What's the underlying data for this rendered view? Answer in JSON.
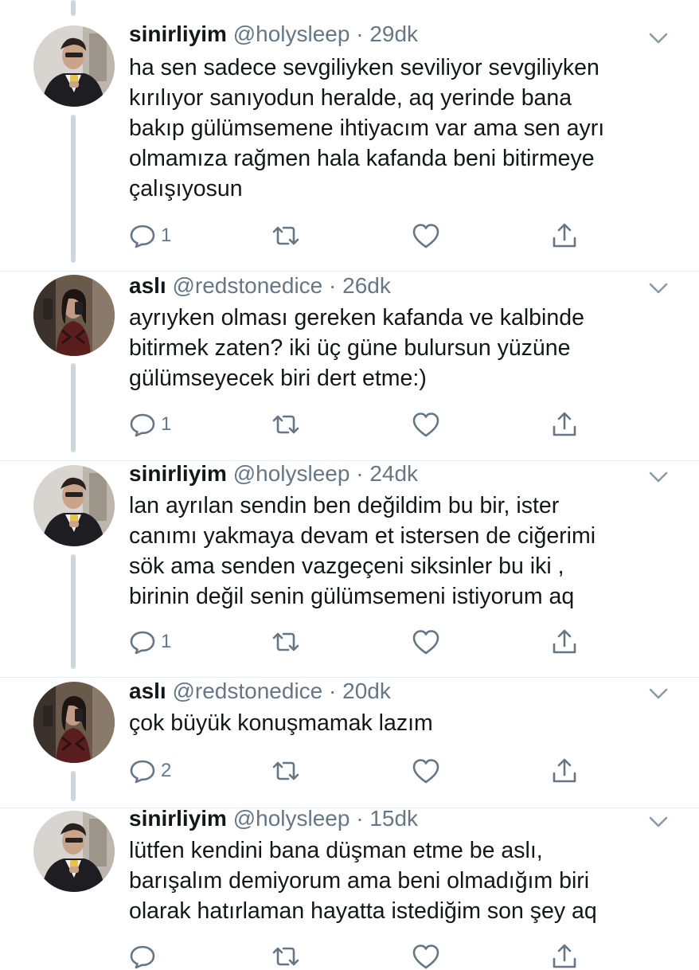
{
  "tweets": [
    {
      "name": "sinirliyim",
      "handle": "@holysleep",
      "separator": "·",
      "time": "29dk",
      "text_lines": [
        "ha sen sadece sevgiliyken seviliyor sevgiliyken",
        "kırılıyor sanıyodun heralde, aq yerinde bana",
        "bakıp gülümsemene ihtiyacım var ama sen ayrı",
        "olmamıza rağmen hala kafanda beni bitirmeye",
        "çalışıyosun"
      ],
      "reply_count": "1"
    },
    {
      "name": "aslı",
      "handle": "@redstonedice",
      "separator": "·",
      "time": "26dk",
      "text_lines": [
        "ayrıyken olması gereken kafanda ve kalbinde",
        "bitirmek zaten? iki üç güne bulursun yüzüne",
        "gülümseyecek biri dert etme:)"
      ],
      "reply_count": "1"
    },
    {
      "name": "sinirliyim",
      "handle": "@holysleep",
      "separator": "·",
      "time": "24dk",
      "text_lines": [
        "lan ayrılan sendin ben değildim bu bir, ister",
        "canımı yakmaya devam et istersen de ciğerimi",
        "sök ama senden vazgeçeni siksinler bu iki ,",
        "birinin değil senin gülümsemeni istiyorum aq"
      ],
      "reply_count": "1"
    },
    {
      "name": "aslı",
      "handle": "@redstonedice",
      "separator": "·",
      "time": "20dk",
      "text_lines": [
        "çok büyük konuşmamak lazım"
      ],
      "reply_count": "2"
    },
    {
      "name": "sinirliyim",
      "handle": "@holysleep",
      "separator": "·",
      "time": "15dk",
      "text_lines": [
        "lütfen kendini bana düşman etme be aslı,",
        "barışalım demiyorum ama beni olmadığım biri",
        "olarak hatırlaman hayatta istediğim son şey aq"
      ],
      "reply_count": ""
    }
  ],
  "icons": {
    "reply": "reply-icon",
    "retweet": "retweet-icon",
    "like": "heart-icon",
    "share": "share-icon",
    "caret": "chevron-down-icon"
  },
  "colors": {
    "text": "#14171a",
    "secondary": "#657786",
    "thread_line": "#ccd6dd",
    "background": "#ffffff"
  }
}
